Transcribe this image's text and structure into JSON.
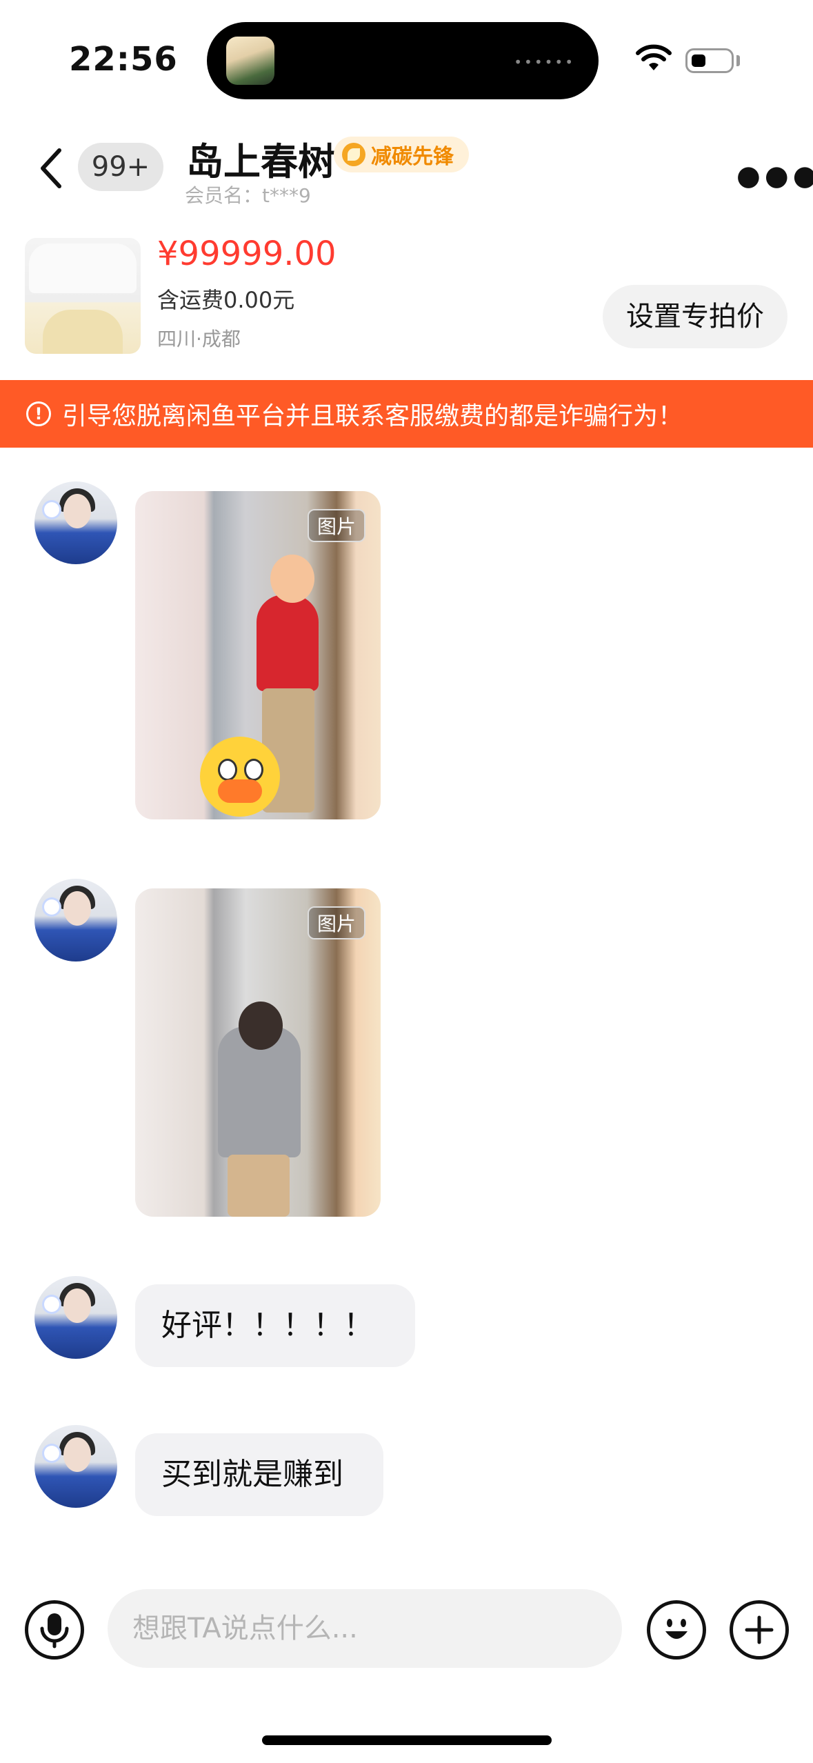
{
  "status_bar": {
    "time": "22:56"
  },
  "header": {
    "unread_count": "99+",
    "chat_name": "岛上春树",
    "badge_label": "减碳先锋",
    "member_label": "会员名：t***9"
  },
  "product": {
    "price": "¥99999.00",
    "shipping": "含运费0.00元",
    "location": "四川·成都",
    "set_price_button": "设置专拍价"
  },
  "warning_banner": {
    "text": "引导您脱离闲鱼平台并且联系客服缴费的都是诈骗行为！"
  },
  "messages": [
    {
      "type": "image",
      "tag": "图片"
    },
    {
      "type": "image",
      "tag": "图片"
    },
    {
      "type": "text",
      "text": "好评！！！！！"
    },
    {
      "type": "text",
      "text": "买到就是赚到"
    }
  ],
  "input_bar": {
    "placeholder": "想跟TA说点什么..."
  },
  "icons": [
    "back-icon",
    "more-icon",
    "wifi-icon",
    "battery-icon",
    "leaf-icon",
    "alert-icon",
    "microphone-icon",
    "emoji-icon",
    "plus-icon"
  ],
  "colors": {
    "warning": "#ff5a26",
    "price": "#ff3b30",
    "badge_text": "#f08a00"
  }
}
